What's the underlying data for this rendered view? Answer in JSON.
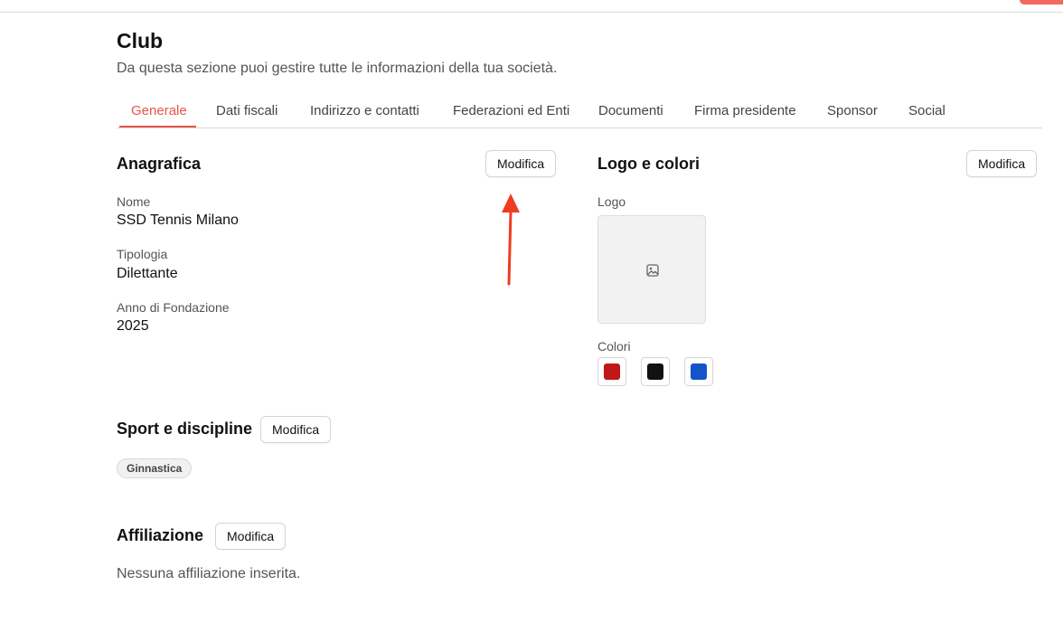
{
  "header": {
    "title": "Club",
    "subtitle": "Da questa sezione puoi gestire tutte le informazioni della tua società."
  },
  "tabs": [
    {
      "label": "Generale",
      "active": true
    },
    {
      "label": "Dati fiscali",
      "active": false
    },
    {
      "label": "Indirizzo e contatti",
      "active": false
    },
    {
      "label": "Federazioni ed Enti",
      "active": false
    },
    {
      "label": "Documenti",
      "active": false
    },
    {
      "label": "Firma presidente",
      "active": false
    },
    {
      "label": "Sponsor",
      "active": false
    },
    {
      "label": "Social",
      "active": false
    }
  ],
  "anagrafica": {
    "title": "Anagrafica",
    "edit_label": "Modifica",
    "fields": [
      {
        "label": "Nome",
        "value": "SSD Tennis Milano"
      },
      {
        "label": "Tipologia",
        "value": "Dilettante"
      },
      {
        "label": "Anno di Fondazione",
        "value": "2025"
      }
    ]
  },
  "logo_colori": {
    "title": "Logo e colori",
    "edit_label": "Modifica",
    "logo_label": "Logo",
    "logo_icon": "image-icon",
    "colors_label": "Colori",
    "colors": [
      "#c01818",
      "#111111",
      "#1554c8"
    ]
  },
  "sport": {
    "title": "Sport e discipline",
    "edit_label": "Modifica",
    "disciplines": [
      "Ginnastica"
    ]
  },
  "affiliazione": {
    "title": "Affiliazione",
    "edit_label": "Modifica",
    "empty_text": "Nessuna affiliazione inserita."
  },
  "theme": {
    "accent": "#e8554a",
    "annotation_arrow": "#f03a22"
  }
}
